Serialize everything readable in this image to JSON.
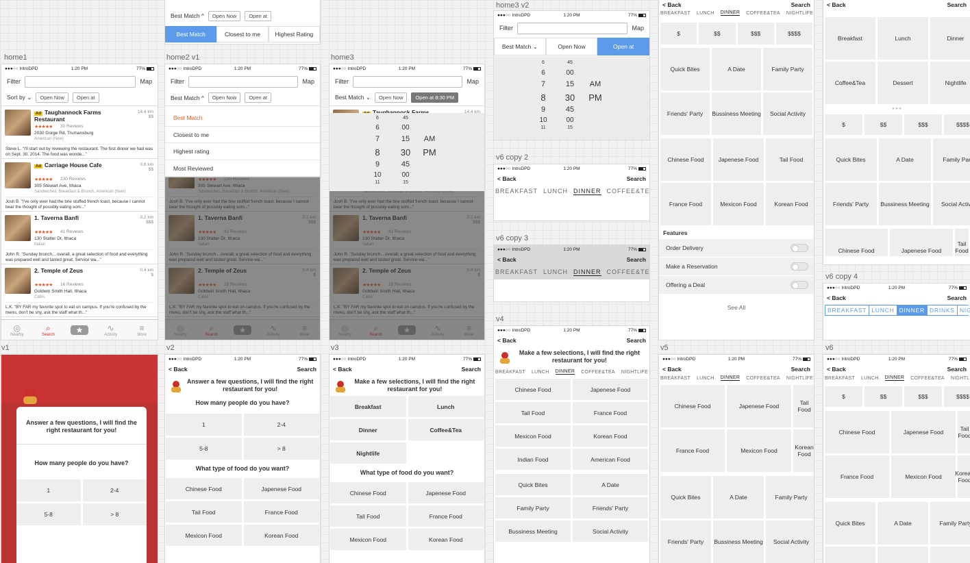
{
  "status": {
    "carrier": "●●●○○ IntroDPD",
    "time": "1:20 PM",
    "battery": "77%"
  },
  "labels": {
    "home1": "home1",
    "home2v1": "home2 v1",
    "home3": "home3",
    "home3v2": "home3 v2",
    "v6copy2": "v6 copy 2",
    "v6copy3": "v6 copy 3",
    "v4": "v4",
    "v5": "v5",
    "v6": "v6",
    "v6copy4": "v6 copy 4",
    "v1": "v1",
    "v2": "v2",
    "v3": "v3"
  },
  "filter": {
    "label": "Filter",
    "map": "Map"
  },
  "sort": {
    "sort_by": "Sort by",
    "best_match": "Best Match",
    "open_now": "Open Now",
    "open_at": "Open at",
    "open_at_time": "Open at 8:30 PM"
  },
  "seg": {
    "best": "Best Match",
    "closest": "Closest to me",
    "highest": "Highest Rating"
  },
  "dropdown": [
    "Best Match",
    "Closest to me",
    "Highest rating",
    "Most Reviewed"
  ],
  "listings": [
    {
      "ad": "Ad",
      "name": "Taughannock Farms Restaurant",
      "reviews": "30 Reviews",
      "addr": "2030 Gorge Rd, Trumansburg",
      "cat": "American (New)",
      "dist": "14.4 km",
      "price": "$$",
      "review": "Steve L. \"I'll start out by reviewing the restaurant. The first dinner we had was on Sept. 30, 2014. The food was wonde...\""
    },
    {
      "ad": "Ad",
      "name": "Carriage House Cafe",
      "reviews": "230 Reviews",
      "addr": "305 Stewart Ave, Ithaca",
      "cat": "Sandwiches, Breakfast & Brunch, American (New)",
      "dist": "0.6 km",
      "price": "$$",
      "review": "Josh B. \"I've only ever had the brie stuffed french toast, because I cannot bear the thought of possibly eating som...\""
    },
    {
      "ad": "",
      "name": "1. Taverna Banfi",
      "reviews": "41 Reviews",
      "addr": "130 Statler Dr, Ithaca",
      "cat": "Italian",
      "dist": "0.2 km",
      "price": "$$$",
      "review": "John R. \"Sunday brunch... overall, a great selection of food and everything was prepared well and tasted great. Service wa...\""
    },
    {
      "ad": "",
      "name": "2. Temple of Zeus",
      "reviews": "16 Reviews",
      "addr": "Goldwin Smith Hall, Ithaca",
      "cat": "Cafes",
      "dist": "0.4 km",
      "price": "$",
      "review": "L.K. \"BY FAR my favorite spot to eat on campus. If you're confused by the menu, don't be shy, ask the staff what th...\""
    }
  ],
  "tabs": [
    "Nearby",
    "Search",
    "",
    "Activity",
    "More"
  ],
  "picker": {
    "hours": [
      "6",
      "6",
      "7",
      "8",
      "9",
      "10",
      "11"
    ],
    "mins": [
      "45",
      "00",
      "15",
      "30",
      "45",
      "00",
      "15"
    ],
    "ampm": [
      "AM",
      "PM"
    ]
  },
  "nav": {
    "back": "< Back",
    "search": "Search"
  },
  "meals": [
    "BREAKFAST",
    "LUNCH",
    "DINNER",
    "COFFEE&TEA",
    "NIGHTLIFE"
  ],
  "meals_c4": [
    "BREAKFAST",
    "LUNCH",
    "DINNER",
    "DRINKS",
    "NIGHTLIFE"
  ],
  "prices": [
    "$",
    "$$",
    "$$$",
    "$$$$"
  ],
  "occasions": [
    "Quick Bites",
    "A Date",
    "Family Party",
    "Friends' Party",
    "Bussiness Meeting",
    "Social Activity"
  ],
  "foods": [
    "Chinese Food",
    "Japenese Food",
    "Tail Food",
    "France Food",
    "Mexicon Food",
    "Korean Food",
    "Indian Food",
    "American Food"
  ],
  "meal_cells": [
    "Breakfast",
    "Lunch",
    "Dinner",
    "Coffee&Tea",
    "Dessert",
    "Nightlife"
  ],
  "features": {
    "title": "Features",
    "items": [
      "Order Delivery",
      "Make a Reservation",
      "Offering a Deal"
    ],
    "see_all": "See All"
  },
  "quiz": {
    "intro_q": "Answer a few questions, I will find the right restaurant for you!",
    "intro_s": "Make a few selections, I will find the right restaurant for you!",
    "people_q": "How many people do you have?",
    "people": [
      "1",
      "2-4",
      "5-8",
      "> 8"
    ],
    "food_q": "What type of food do you want?",
    "v3_meals": [
      "Breakfast",
      "Lunch",
      "Dinner",
      "Coffee&Tea",
      "Nightlife"
    ]
  }
}
